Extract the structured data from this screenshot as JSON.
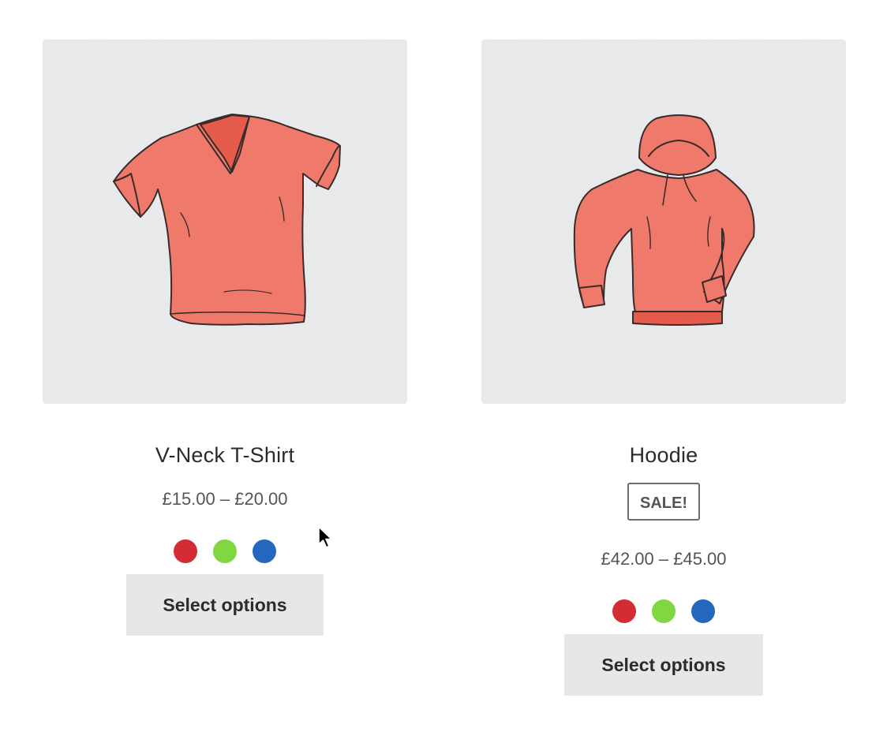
{
  "colors": {
    "image_bg": "#e6e8ea",
    "garment": "#ef7a6b",
    "garment_shade": "#e55c4c",
    "button_bg": "#e6e7e8"
  },
  "products": [
    {
      "title": "V-Neck T-Shirt",
      "price": "£15.00 – £20.00",
      "swatches": [
        {
          "name": "red",
          "color": "#d52b35"
        },
        {
          "name": "green",
          "color": "#81d742"
        },
        {
          "name": "blue",
          "color": "#2468bd"
        }
      ],
      "button_label": "Select options"
    },
    {
      "title": "Hoodie",
      "badge": "SALE!",
      "price": "£42.00 – £45.00",
      "swatches": [
        {
          "name": "red",
          "color": "#d52b35"
        },
        {
          "name": "green",
          "color": "#81d742"
        },
        {
          "name": "blue",
          "color": "#2468bd"
        }
      ],
      "button_label": "Select options"
    }
  ]
}
